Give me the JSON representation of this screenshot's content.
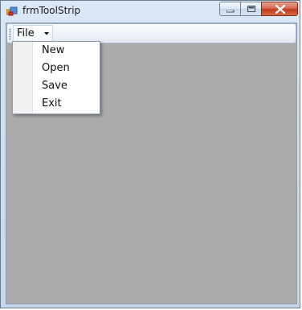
{
  "window": {
    "title": "frmToolStrip"
  },
  "toolstrip": {
    "file_label": "File"
  },
  "file_menu": {
    "items": [
      {
        "label": "New"
      },
      {
        "label": "Open"
      },
      {
        "label": "Save"
      },
      {
        "label": "Exit"
      }
    ]
  },
  "colors": {
    "client_background": "#ababab",
    "close_button": "#c0391c"
  },
  "icons": [
    "app-icon",
    "minimize-icon",
    "maximize-icon",
    "close-icon",
    "grip-icon",
    "dropdown-arrow-icon"
  ]
}
